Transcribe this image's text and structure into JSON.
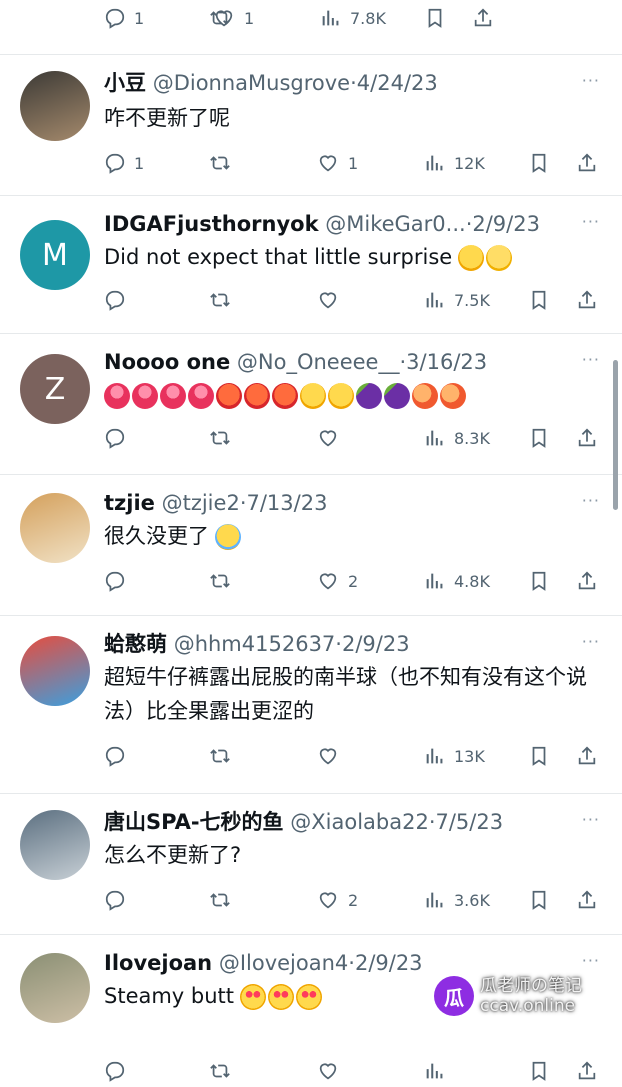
{
  "top_actions": {
    "reply_count": "1",
    "like_count": "1",
    "views": "7.8K"
  },
  "tweets": [
    {
      "name": "小豆",
      "handle": "@DionnaMusgrove",
      "sep": "·",
      "date": "4/24/23",
      "text": "咋不更新了呢",
      "emojis": [],
      "reply_count": "1",
      "retweet_count": "",
      "like_count": "1",
      "views": "12K",
      "avatar": {
        "type": "photo",
        "colors": [
          "#3c3a36",
          "#a58a6c"
        ]
      }
    },
    {
      "name": "IDGAFjusthornyok",
      "handle": "@MikeGar0...",
      "sep": "·",
      "date": "2/9/23",
      "text": "Did not expect that little surprise",
      "emojis": [
        "rofl",
        "shushing-face"
      ],
      "reply_count": "",
      "retweet_count": "",
      "like_count": "",
      "views": "7.5K",
      "avatar": {
        "type": "letter",
        "letter": "M",
        "color": "#1e98a6"
      }
    },
    {
      "name": "Noooo one",
      "handle": "@No_Oneeee__",
      "sep": "·",
      "date": "3/16/23",
      "text": "",
      "emojis": [
        "tongue",
        "tongue",
        "tongue",
        "tongue",
        "hot-face",
        "hot-face",
        "hot-face",
        "relieved",
        "relieved",
        "eggplant",
        "eggplant",
        "peach",
        "peach"
      ],
      "reply_count": "",
      "retweet_count": "",
      "like_count": "",
      "views": "8.3K",
      "avatar": {
        "type": "letter",
        "letter": "Z",
        "color": "#7b625d"
      }
    },
    {
      "name": "tzjie",
      "handle": "@tzjie2",
      "sep": "·",
      "date": "7/13/23",
      "text": "很久没更了",
      "emojis": [
        "joy"
      ],
      "reply_count": "",
      "retweet_count": "",
      "like_count": "2",
      "views": "4.8K",
      "avatar": {
        "type": "photo",
        "colors": [
          "#d4a05c",
          "#f1e2c6"
        ]
      }
    },
    {
      "name": "蛤憨萌",
      "handle": "@hhm4152637",
      "sep": "·",
      "date": "2/9/23",
      "text": "超短牛仔裤露出屁股的南半球（也不知有没有这个说法）比全果露出更涩的",
      "emojis": [],
      "reply_count": "",
      "retweet_count": "",
      "like_count": "",
      "views": "13K",
      "avatar": {
        "type": "photo",
        "colors": [
          "#e84c3d",
          "#3aa0e0"
        ]
      }
    },
    {
      "name": "唐山SPA-七秒的鱼",
      "handle": "@Xiaolaba22",
      "sep": "·",
      "date": "7/5/23",
      "text": "怎么不更新了?",
      "emojis": [],
      "reply_count": "",
      "retweet_count": "",
      "like_count": "2",
      "views": "3.6K",
      "avatar": {
        "type": "photo",
        "colors": [
          "#5b6f80",
          "#c8d0d6"
        ]
      }
    },
    {
      "name": "Ilovejoan",
      "handle": "@Ilovejoan4",
      "sep": "·",
      "date": "2/9/23",
      "text": "Steamy butt",
      "emojis": [
        "heart-eyes",
        "heart-eyes",
        "heart-eyes"
      ],
      "reply_count": "",
      "retweet_count": "",
      "like_count": "",
      "views": "",
      "avatar": {
        "type": "photo",
        "colors": [
          "#8a8f74",
          "#cdbfa6"
        ]
      }
    }
  ],
  "more_label": "···",
  "watermark": {
    "logo": "瓜",
    "line1": "瓜老师の笔记",
    "line2": "ccav.online"
  },
  "colors": {
    "text": "#0f1419",
    "secondary": "#536471",
    "divider": "#e6e9eb"
  }
}
